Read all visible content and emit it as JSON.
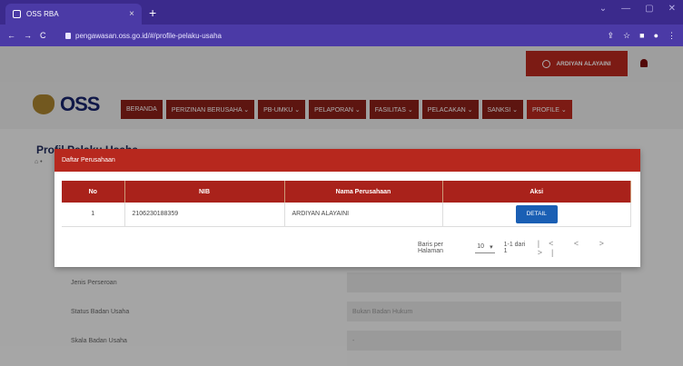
{
  "browser": {
    "tab_title": "OSS RBA",
    "tab_close": "×",
    "new_tab": "+",
    "url": "pengawasan.oss.go.id/#/profile-pelaku-usaha",
    "nav_back": "←",
    "nav_forward": "→",
    "nav_reload": "C",
    "window_controls": [
      "⌄",
      "—",
      "▢",
      "✕"
    ]
  },
  "header": {
    "user_name": "ARDIYAN ALAYAINI"
  },
  "logo": {
    "text": "OSS"
  },
  "nav": {
    "items": [
      {
        "label": "BERANDA"
      },
      {
        "label": "PERIZINAN BERUSAHA ⌄"
      },
      {
        "label": "PB-UMKU ⌄"
      },
      {
        "label": "PELAPORAN ⌄"
      },
      {
        "label": "FASILITAS ⌄"
      },
      {
        "label": "PELACAKAN ⌄"
      },
      {
        "label": "SANKSI ⌄"
      },
      {
        "label": "PROFILE ⌄"
      }
    ]
  },
  "background": {
    "title": "Profil Pelaku Usaha",
    "breadcrumb": "⌂ •",
    "rows": [
      {
        "label": "Jenis Perseroan",
        "value": ""
      },
      {
        "label": "Status Badan Usaha",
        "value": "Bukan Badan Hukum"
      },
      {
        "label": "Skala Badan Usaha",
        "value": "-"
      }
    ]
  },
  "modal": {
    "title": "Daftar Perusahaan",
    "columns": [
      "No",
      "NIB",
      "Nama Perusahaan",
      "Aksi"
    ],
    "rows": [
      {
        "no": "1",
        "nib": "2106230188359",
        "nama": "ARDIYAN ALAYAINI",
        "aksi": "DETAIL"
      }
    ],
    "pagination": {
      "label": "Baris per Halaman",
      "per_page": "10",
      "range": "1-1 dari 1",
      "controls": "|< < > >|"
    }
  },
  "colors": {
    "brand_red": "#b7281e",
    "nav_dark_red": "#8a1f19",
    "detail_blue": "#1a5fb4",
    "browser_purple": "#4b3aa6"
  }
}
